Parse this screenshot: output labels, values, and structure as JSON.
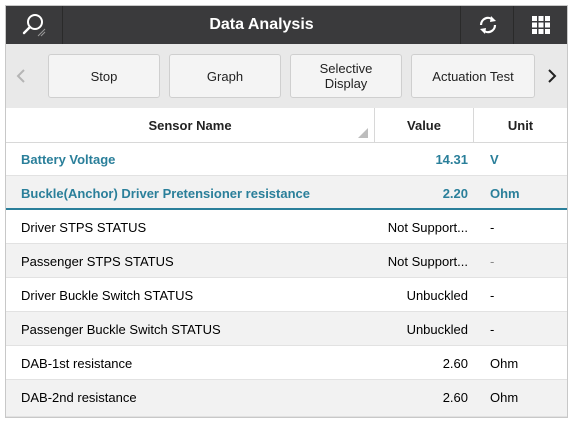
{
  "header": {
    "title": "Data Analysis",
    "left_icon": "search-icon",
    "refresh_icon": "refresh-icon",
    "grid_icon": "grid-icon"
  },
  "toolbar": {
    "buttons": [
      "Stop",
      "Graph",
      "Selective\nDisplay",
      "Actuation Test"
    ]
  },
  "table": {
    "columns": [
      "Sensor Name",
      "Value",
      "Unit"
    ],
    "rows": [
      {
        "name": "Battery Voltage",
        "value": "14.31",
        "unit": "V"
      },
      {
        "name": "Buckle(Anchor) Driver Pretensioner resistance",
        "value": "2.20",
        "unit": "Ohm"
      },
      {
        "name": "Driver STPS STATUS",
        "value": "Not Support...",
        "unit": "-"
      },
      {
        "name": "Passenger STPS STATUS",
        "value": "Not Support...",
        "unit": "-"
      },
      {
        "name": "Driver Buckle Switch STATUS",
        "value": "Unbuckled",
        "unit": "-"
      },
      {
        "name": "Passenger Buckle Switch STATUS",
        "value": "Unbuckled",
        "unit": "-"
      },
      {
        "name": "DAB-1st resistance",
        "value": "2.60",
        "unit": "Ohm"
      },
      {
        "name": "DAB-2nd resistance",
        "value": "2.60",
        "unit": "Ohm"
      }
    ]
  },
  "colors": {
    "titlebar": "#3a3a3c",
    "selected_text": "#2a7f9a"
  }
}
